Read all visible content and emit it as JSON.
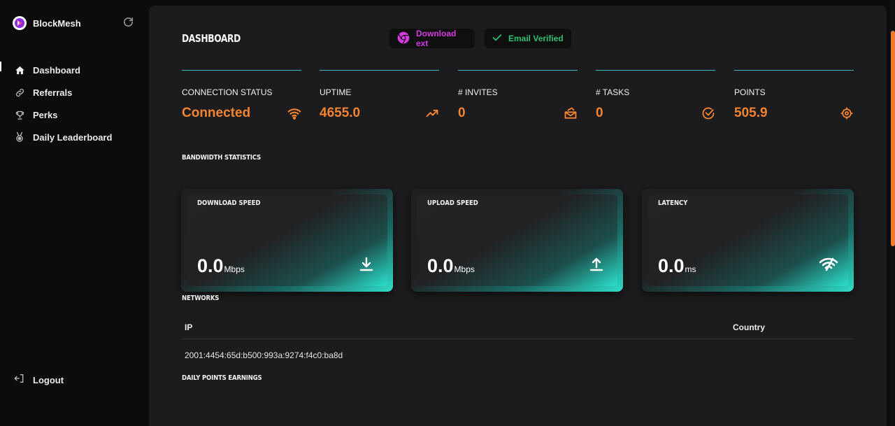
{
  "brand": {
    "name": "BlockMesh"
  },
  "sidebar": {
    "items": [
      {
        "label": "Dashboard",
        "icon": "home-icon"
      },
      {
        "label": "Referrals",
        "icon": "link-icon"
      },
      {
        "label": "Perks",
        "icon": "trophy-icon"
      },
      {
        "label": "Daily Leaderboard",
        "icon": "medal-icon"
      }
    ],
    "logout_label": "Logout"
  },
  "header": {
    "title": "DASHBOARD",
    "download_ext_label": "Download ext",
    "email_verified_label": "Email Verified"
  },
  "stats": [
    {
      "label": "CONNECTION STATUS",
      "value": "Connected",
      "icon": "wifi-icon"
    },
    {
      "label": "UPTIME",
      "value": "4655.0",
      "icon": "trending-up-icon"
    },
    {
      "label": "# INVITES",
      "value": "0",
      "icon": "invites-icon"
    },
    {
      "label": "# TASKS",
      "value": "0",
      "icon": "check-circle-icon"
    },
    {
      "label": "POINTS",
      "value": "505.9",
      "icon": "target-icon"
    }
  ],
  "bandwidth": {
    "title": "BANDWIDTH STATISTICS",
    "cards": [
      {
        "title": "DOWNLOAD SPEED",
        "value": "0.0",
        "unit": "Mbps",
        "icon": "download-icon"
      },
      {
        "title": "UPLOAD SPEED",
        "value": "0.0",
        "unit": "Mbps",
        "icon": "upload-icon"
      },
      {
        "title": "LATENCY",
        "value": "0.0",
        "unit": "ms",
        "icon": "signal-icon"
      }
    ]
  },
  "networks": {
    "title": "NETWORKS",
    "columns": [
      "IP",
      "Country"
    ],
    "rows": [
      {
        "ip": "2001:4454:65d:b500:993a:9274:f4c0:ba8d",
        "country": ""
      }
    ]
  },
  "daily_points": {
    "title": "DAILY POINTS EARNINGS"
  },
  "colors": {
    "accent": "#f3832f",
    "teal": "#2fdcc8",
    "rule": "#3fb7c0",
    "chrome": "#d63adf",
    "verified": "#2fbf70"
  }
}
